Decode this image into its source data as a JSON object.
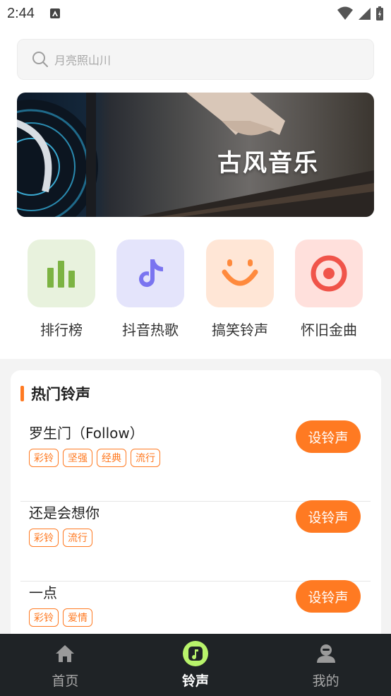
{
  "status_bar": {
    "time": "2:44"
  },
  "search": {
    "placeholder": "月亮照山川"
  },
  "banner": {
    "title": "古风音乐"
  },
  "categories": [
    {
      "label": "排行榜",
      "icon": "bar-chart-icon",
      "bg": "#e8f2dd",
      "color": "#7cb342"
    },
    {
      "label": "抖音热歌",
      "icon": "music-note-icon",
      "bg": "#e4e4fb",
      "color": "#7a74f0"
    },
    {
      "label": "搞笑铃声",
      "icon": "smile-icon",
      "bg": "#ffe6d6",
      "color": "#ff8a3d"
    },
    {
      "label": "怀旧金曲",
      "icon": "target-icon",
      "bg": "#ffe0dc",
      "color": "#f0544a"
    }
  ],
  "hot": {
    "title": "热门铃声",
    "items": [
      {
        "title": "罗生门（Follow）",
        "tags": [
          "彩铃",
          "坚强",
          "经典",
          "流行"
        ],
        "button": "设铃声"
      },
      {
        "title": "还是会想你",
        "tags": [
          "彩铃",
          "流行"
        ],
        "button": "设铃声"
      },
      {
        "title": "一点",
        "tags": [
          "彩铃",
          "爱情"
        ],
        "button": "设铃声"
      }
    ]
  },
  "nav": [
    {
      "label": "首页",
      "icon": "home-icon",
      "active": false
    },
    {
      "label": "铃声",
      "icon": "ringtone-icon",
      "active": true
    },
    {
      "label": "我的",
      "icon": "profile-icon",
      "active": false
    }
  ],
  "colors": {
    "accent": "#ff7a22",
    "nav_bg": "#1f2326",
    "nav_active_icon": "#b8f36b"
  }
}
